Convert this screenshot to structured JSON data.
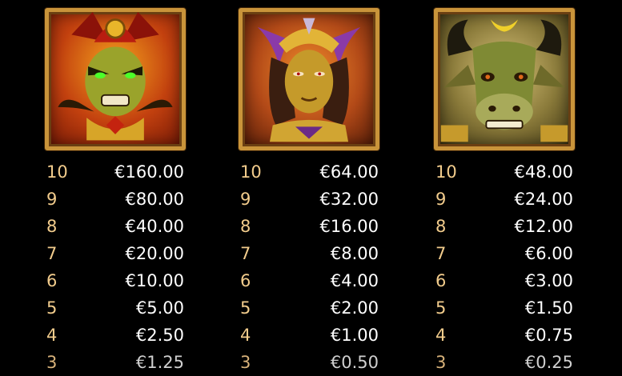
{
  "symbols": [
    {
      "icon": "demon-warrior-icon",
      "accent": "#c3410f",
      "payouts": [
        {
          "count": "10",
          "amount": "€160.00"
        },
        {
          "count": "9",
          "amount": "€80.00"
        },
        {
          "count": "8",
          "amount": "€40.00"
        },
        {
          "count": "7",
          "amount": "€20.00"
        },
        {
          "count": "6",
          "amount": "€10.00"
        },
        {
          "count": "5",
          "amount": "€5.00"
        },
        {
          "count": "4",
          "amount": "€2.50"
        },
        {
          "count": "3",
          "amount": "€1.25"
        }
      ]
    },
    {
      "icon": "golden-queen-icon",
      "accent": "#b34a18",
      "payouts": [
        {
          "count": "10",
          "amount": "€64.00"
        },
        {
          "count": "9",
          "amount": "€32.00"
        },
        {
          "count": "8",
          "amount": "€16.00"
        },
        {
          "count": "7",
          "amount": "€8.00"
        },
        {
          "count": "6",
          "amount": "€4.00"
        },
        {
          "count": "5",
          "amount": "€2.00"
        },
        {
          "count": "4",
          "amount": "€1.00"
        },
        {
          "count": "3",
          "amount": "€0.50"
        }
      ]
    },
    {
      "icon": "bull-minotaur-icon",
      "accent": "#8a7a3a",
      "payouts": [
        {
          "count": "10",
          "amount": "€48.00"
        },
        {
          "count": "9",
          "amount": "€24.00"
        },
        {
          "count": "8",
          "amount": "€12.00"
        },
        {
          "count": "7",
          "amount": "€6.00"
        },
        {
          "count": "6",
          "amount": "€3.00"
        },
        {
          "count": "5",
          "amount": "€1.50"
        },
        {
          "count": "4",
          "amount": "€0.75"
        },
        {
          "count": "3",
          "amount": "€0.25"
        }
      ]
    }
  ]
}
